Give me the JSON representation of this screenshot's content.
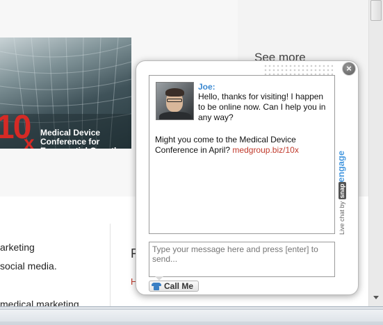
{
  "page": {
    "banner": {
      "big_number": "10",
      "suffix": "x",
      "caption": "Medical Device Conference for Exponential Growth"
    },
    "see_more": "See more",
    "body_lines": [
      "arketing",
      "social media.",
      "medical marketing"
    ],
    "right_col_letter": "F",
    "right_col_red": "H"
  },
  "chat": {
    "agent_name": "Joe:",
    "agent_message": "Hello, thanks for visiting! I happen to be online now. Can I help you in any way?",
    "followup_text": "Might you come to the Medical Device Conference in April?",
    "followup_link": "medgroup.biz/10x",
    "brand_prefix": "Live chat by",
    "brand_snap": "snap",
    "brand_engage": "engage",
    "input_placeholder": "Type your message here and press [enter] to send...",
    "call_me_label": "Call Me",
    "close_glyph": "×"
  },
  "icons": {
    "close": "close-icon",
    "phone": "phone-icon",
    "avatar": "agent-avatar"
  },
  "colors": {
    "agent_name": "#3a88d1",
    "link": "#c0392b",
    "brand_engage": "#4b9be0",
    "banner_accent": "#d62a25"
  }
}
